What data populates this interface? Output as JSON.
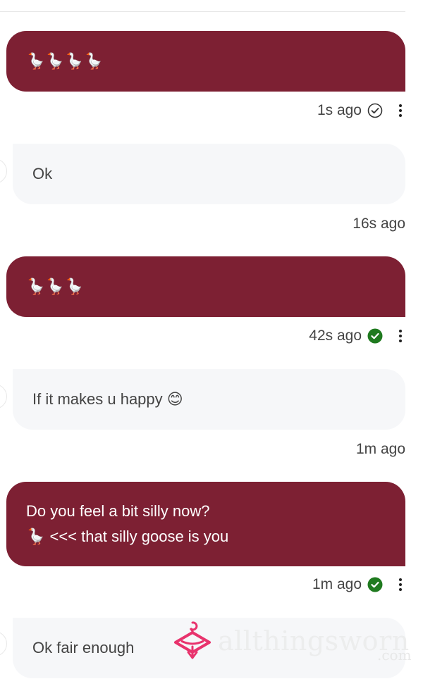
{
  "messages": [
    {
      "direction": "sent",
      "text": "🪿🪿🪿🪿",
      "time": "1s ago",
      "status": "delivered"
    },
    {
      "direction": "received",
      "text": "Ok",
      "time": "16s ago"
    },
    {
      "direction": "sent",
      "text": "🪿🪿🪿",
      "time": "42s ago",
      "status": "read"
    },
    {
      "direction": "received",
      "text": "If it makes u happy 😊",
      "time": "1m ago"
    },
    {
      "direction": "sent",
      "text_lines": [
        "Do you feel a bit silly now?",
        "🪿 <<< that silly goose is you"
      ],
      "time": "1m ago",
      "status": "read"
    },
    {
      "direction": "received",
      "text": "Ok fair enough"
    }
  ],
  "watermark": {
    "text": "allthingsworn",
    "sub": ".com"
  },
  "icons": {
    "delivered": "check-circle-outline-icon",
    "read": "check-circle-filled-icon",
    "menu": "kebab-menu-icon"
  },
  "colors": {
    "sent_bubble": "#7d2033",
    "received_bubble": "#f6f7f9",
    "read_check": "#1f7a1f",
    "watermark_logo": "#e8336d"
  }
}
